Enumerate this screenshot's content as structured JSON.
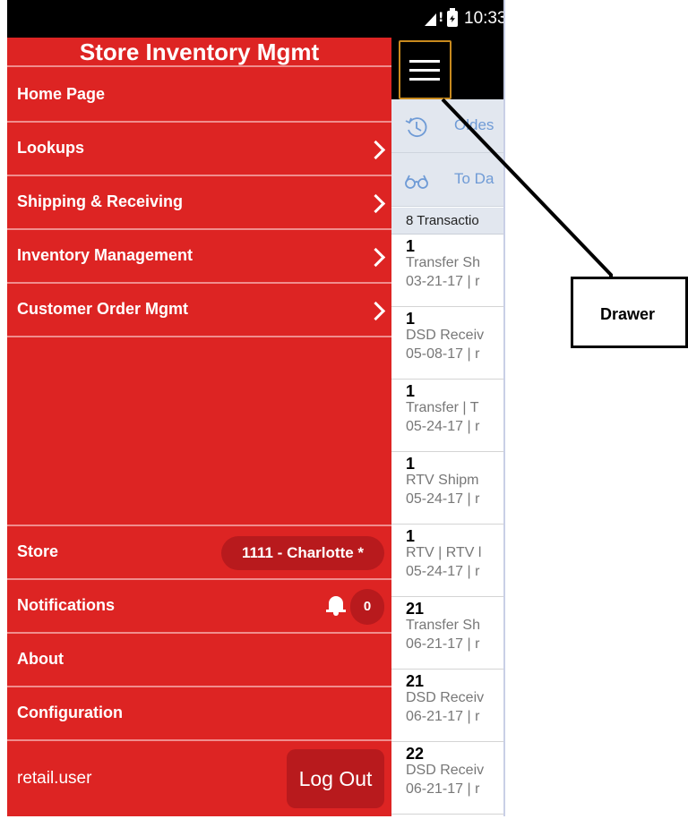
{
  "status_bar": {
    "signal_mark": "!",
    "time": "10:33"
  },
  "drawer": {
    "title": "Store Inventory Mgmt",
    "nav_items": [
      {
        "label": "Home Page",
        "has_submenu": false
      },
      {
        "label": "Lookups",
        "has_submenu": true
      },
      {
        "label": "Shipping & Receiving",
        "has_submenu": true
      },
      {
        "label": "Inventory Management",
        "has_submenu": true
      },
      {
        "label": "Customer Order Mgmt",
        "has_submenu": true
      }
    ],
    "store": {
      "label": "Store",
      "value": "1111 - Charlotte *"
    },
    "notifications": {
      "label": "Notifications",
      "count": "0"
    },
    "about_label": "About",
    "configuration_label": "Configuration",
    "username": "retail.user",
    "logout_label": "Log Out",
    "background_color": "#dd2423"
  },
  "app": {
    "filters": [
      {
        "label": "Oldes",
        "icon": "history-icon"
      },
      {
        "label": "To Da",
        "icon": "glasses-icon"
      }
    ],
    "transaction_count": "8 Transactio",
    "transactions": [
      {
        "qty": "1",
        "type": "Transfer Sh",
        "date": "03-21-17 | r"
      },
      {
        "qty": "1",
        "type": "DSD Receiv",
        "date": "05-08-17 | r"
      },
      {
        "qty": "1",
        "type": "Transfer | T",
        "date": "05-24-17 | r"
      },
      {
        "qty": "1",
        "type": "RTV Shipm",
        "date": "05-24-17 | r"
      },
      {
        "qty": "1",
        "type": "RTV | RTV l",
        "date": "05-24-17 | r"
      },
      {
        "qty": "21",
        "type": "Transfer Sh",
        "date": "06-21-17 | r"
      },
      {
        "qty": "21",
        "type": "DSD Receiv",
        "date": "06-21-17 | r"
      },
      {
        "qty": "22",
        "type": "DSD Receiv",
        "date": "06-21-17 | r"
      }
    ]
  },
  "callout": {
    "label": "Drawer"
  }
}
